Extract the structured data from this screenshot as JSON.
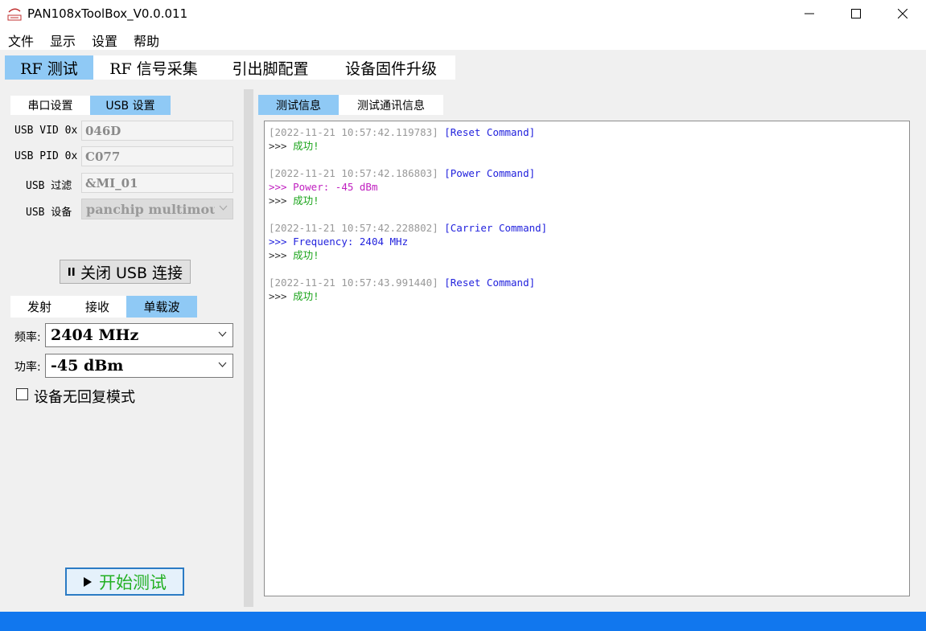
{
  "window": {
    "title": "PAN108xToolBox_V0.0.011",
    "icon": "app-logo-icon"
  },
  "menu": [
    "文件",
    "显示",
    "设置",
    "帮助"
  ],
  "main_tabs": [
    {
      "label": "RF 测试",
      "active": true
    },
    {
      "label": "RF 信号采集",
      "active": false
    },
    {
      "label": "引出脚配置",
      "active": false
    },
    {
      "label": "设备固件升级",
      "active": false
    }
  ],
  "conn_tabs": [
    {
      "label": "串口设置",
      "active": false
    },
    {
      "label": "USB 设置",
      "active": true
    }
  ],
  "usb": {
    "vid_label": "USB VID 0x",
    "vid_value": "046D",
    "pid_label": "USB PID 0x",
    "pid_value": "C077",
    "filter_label": "USB 过滤",
    "filter_value": "&MI_01",
    "device_label": "USB 设备",
    "device_value": "panchip multimouse"
  },
  "close_usb_button": "关闭 USB 连接",
  "mode_tabs": [
    {
      "label": "发射",
      "active": false
    },
    {
      "label": "接收",
      "active": false
    },
    {
      "label": "单载波",
      "active": true
    }
  ],
  "freq": {
    "label": "频率:",
    "value": "2404 MHz"
  },
  "power": {
    "label": "功率:",
    "value": "-45 dBm"
  },
  "no_reply_mode": {
    "label": "设备无回复模式",
    "checked": false
  },
  "start_button": "开始测试",
  "right_tabs": [
    {
      "label": "测试信息",
      "active": true
    },
    {
      "label": "测试通讯信息",
      "active": false
    }
  ],
  "log": [
    {
      "timestamp": "[2022-11-21 10:57:42.119783]",
      "command": "[Reset Command]",
      "lines": [
        {
          "prefix": ">>>",
          "text": "成功!",
          "kind": "ok"
        }
      ]
    },
    {
      "timestamp": "[2022-11-21 10:57:42.186803]",
      "command": "[Power Command]",
      "lines": [
        {
          "prefix": ">>>",
          "text": "Power: -45 dBm",
          "kind": "pw"
        },
        {
          "prefix": ">>>",
          "text": "成功!",
          "kind": "ok"
        }
      ]
    },
    {
      "timestamp": "[2022-11-21 10:57:42.228802]",
      "command": "[Carrier Command]",
      "lines": [
        {
          "prefix": ">>>",
          "text": "Frequency: 2404 MHz",
          "kind": "fq"
        },
        {
          "prefix": ">>>",
          "text": "成功!",
          "kind": "ok"
        }
      ]
    },
    {
      "timestamp": "[2022-11-21 10:57:43.991440]",
      "command": "[Reset Command]",
      "lines": [
        {
          "prefix": ">>>",
          "text": "成功!",
          "kind": "ok"
        }
      ]
    }
  ],
  "colors": {
    "active_tab": "#8fc9f5",
    "status_bar": "#1177ee",
    "success_text": "#19a319",
    "command_text": "#2222dd",
    "power_text": "#c020c0"
  }
}
